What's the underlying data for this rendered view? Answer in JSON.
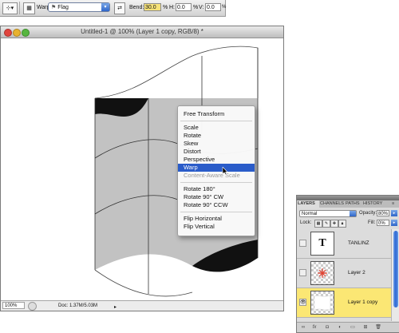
{
  "options_bar": {
    "tool_icon_label": "▾",
    "warp_label": "Warp:",
    "warp_style": "Flag",
    "bend_label": "Bend:",
    "bend_value": "30.0",
    "bend_unit": "%",
    "h_label": "H:",
    "h_value": "0.0",
    "h_unit": "%",
    "v_label": "V:",
    "v_value": "0.0",
    "v_unit": "%"
  },
  "document": {
    "title": "Untitled-1 @ 100% (Layer 1 copy, RGB/8) *",
    "zoom": "100%",
    "doc_info": "Doc: 1.37M/5.03M"
  },
  "context_menu": {
    "items": [
      {
        "label": "Free Transform",
        "state": "normal"
      },
      {
        "label": "Scale",
        "state": "normal"
      },
      {
        "label": "Rotate",
        "state": "normal"
      },
      {
        "label": "Skew",
        "state": "normal"
      },
      {
        "label": "Distort",
        "state": "normal"
      },
      {
        "label": "Perspective",
        "state": "normal"
      },
      {
        "label": "Warp",
        "state": "selected"
      },
      {
        "label": "Content-Aware Scale",
        "state": "disabled"
      },
      {
        "label": "Rotate 180°",
        "state": "normal"
      },
      {
        "label": "Rotate 90° CW",
        "state": "normal"
      },
      {
        "label": "Rotate 90° CCW",
        "state": "normal"
      },
      {
        "label": "Flip Horizontal",
        "state": "normal"
      },
      {
        "label": "Flip Vertical",
        "state": "normal"
      }
    ]
  },
  "layers_panel": {
    "tabs": [
      "LAYERS",
      "CHANNELS",
      "PATHS",
      "HISTORY"
    ],
    "blend_mode": "Normal",
    "opacity_label": "Opacity:",
    "opacity_value": "80%",
    "lock_label": "Lock:",
    "fill_label": "Fill:",
    "fill_value": "0%",
    "layers": [
      {
        "name": "TANLINZ",
        "thumb": "T",
        "visible": false,
        "active": false
      },
      {
        "name": "Layer 2",
        "thumb": "",
        "visible": false,
        "active": false
      },
      {
        "name": "Layer 1 copy",
        "thumb": "",
        "visible": true,
        "active": true
      }
    ]
  },
  "colors": {
    "selection_blue": "#2a5cc9",
    "active_layer_yellow": "#fbe774",
    "bend_field_highlight": "#f6e27a"
  }
}
